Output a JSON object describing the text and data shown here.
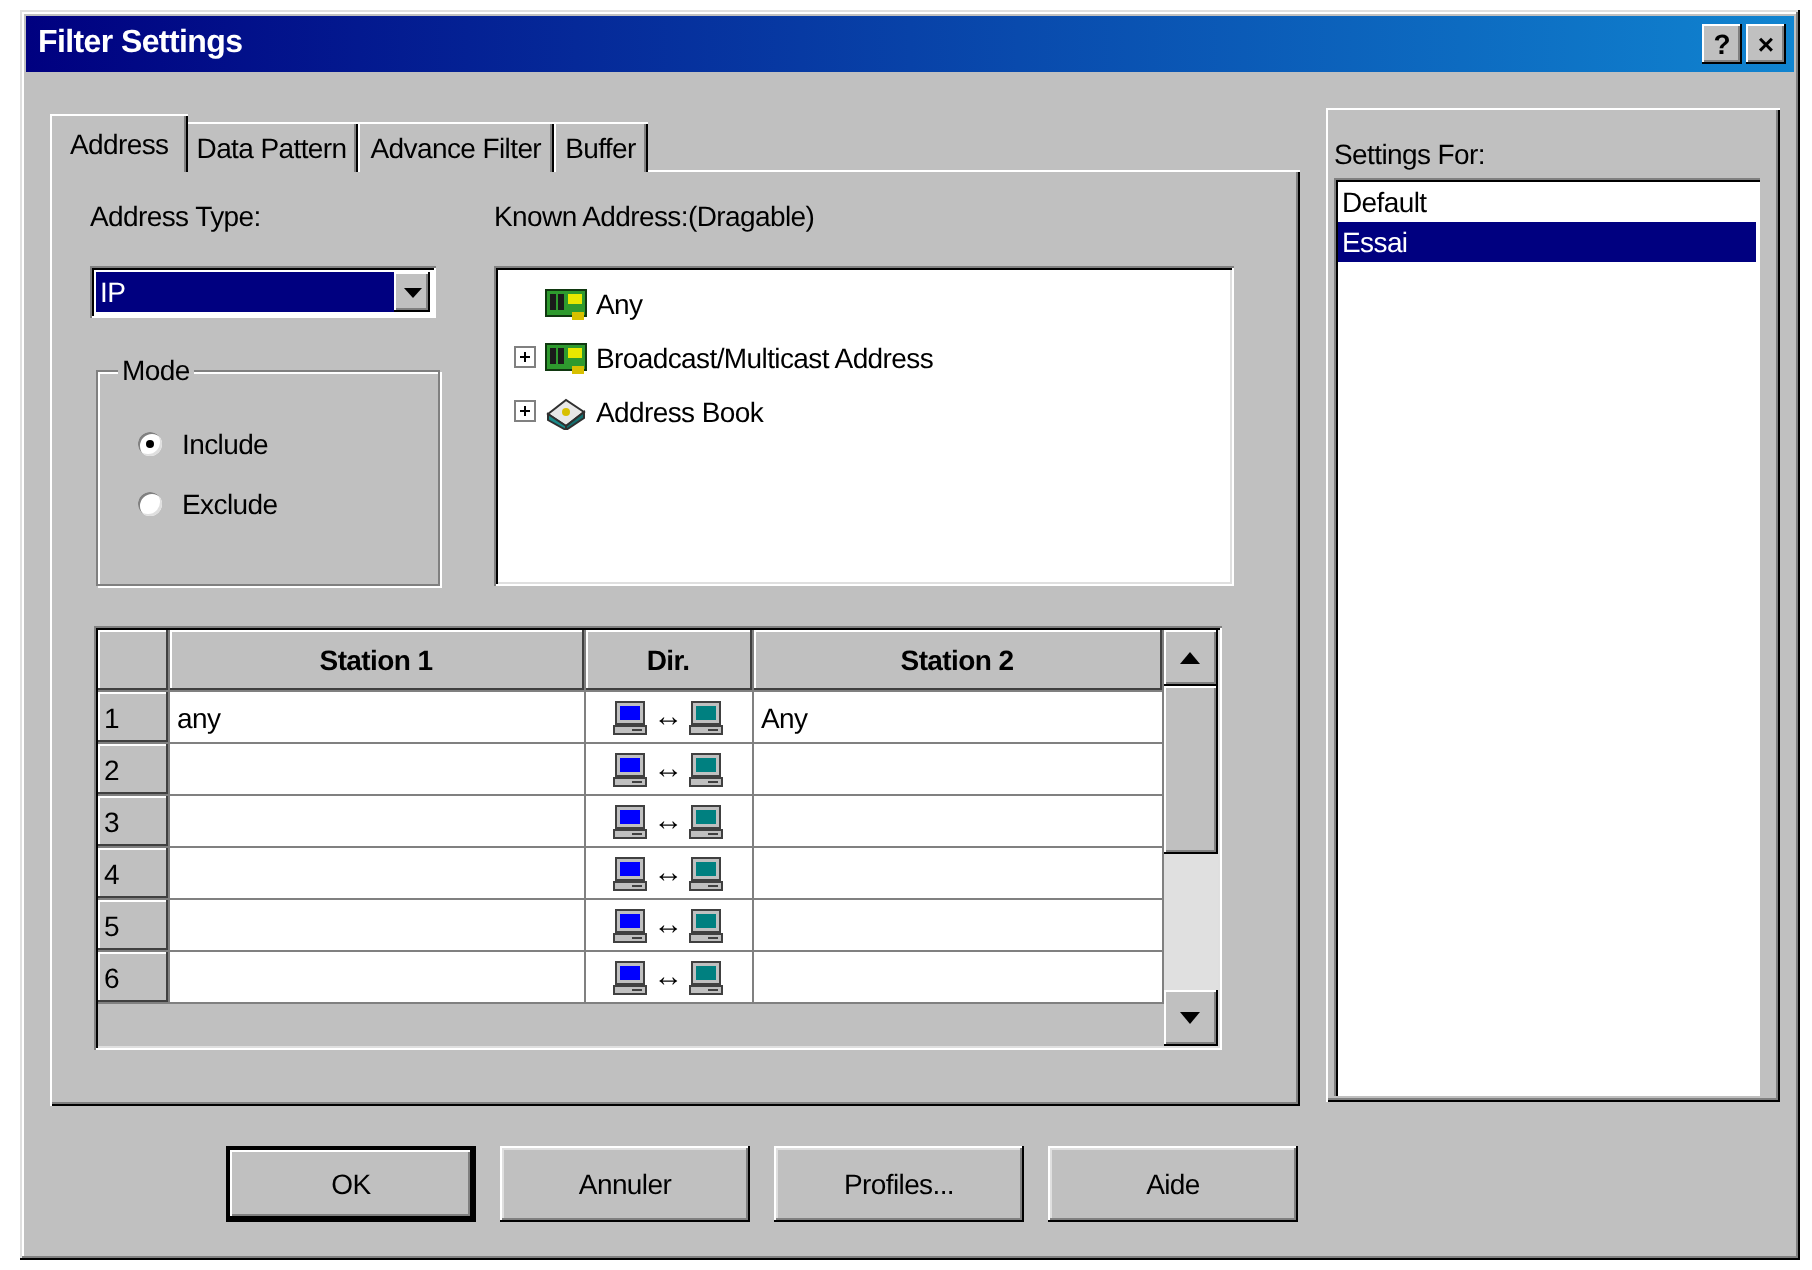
{
  "window": {
    "title": "Filter Settings",
    "title_buttons": [
      "?",
      "×"
    ]
  },
  "tabs": [
    {
      "label": "Address",
      "selected": true
    },
    {
      "label": "Data Pattern",
      "selected": false
    },
    {
      "label": "Advance Filter",
      "selected": false
    },
    {
      "label": "Buffer",
      "selected": false
    }
  ],
  "address_type": {
    "label": "Address Type:",
    "value": "IP"
  },
  "mode": {
    "label": "Mode",
    "options": [
      {
        "label": "Include",
        "selected": true
      },
      {
        "label": "Exclude",
        "selected": false
      }
    ]
  },
  "known_address": {
    "label": "Known Address:(Dragable)",
    "tree": [
      {
        "label": "Any",
        "kind": "network",
        "expandable": false
      },
      {
        "label": "Broadcast/Multicast Address",
        "kind": "network",
        "expandable": true
      },
      {
        "label": "Address Book",
        "kind": "book",
        "expandable": true
      }
    ]
  },
  "grid": {
    "columns": [
      "Station 1",
      "Dir.",
      "Station 2"
    ],
    "rows": [
      {
        "number": "1",
        "station_1": "any",
        "direction": "↔",
        "station_2": "Any"
      },
      {
        "number": "2",
        "direction": "↔"
      },
      {
        "number": "3",
        "direction": "↔"
      },
      {
        "number": "4",
        "direction": "↔"
      },
      {
        "number": "5",
        "direction": "↔"
      },
      {
        "number": "6",
        "direction": "↔"
      }
    ]
  },
  "settings_for": {
    "label": "Settings For:",
    "items": [
      {
        "label": "Default",
        "selected": false
      },
      {
        "label": "Essai",
        "selected": true
      }
    ]
  },
  "buttons": [
    {
      "label": "OK",
      "default": true
    },
    {
      "label": "Annuler",
      "default": false
    },
    {
      "label": "Profiles...",
      "default": false
    },
    {
      "label": "Aide",
      "default": false
    }
  ]
}
